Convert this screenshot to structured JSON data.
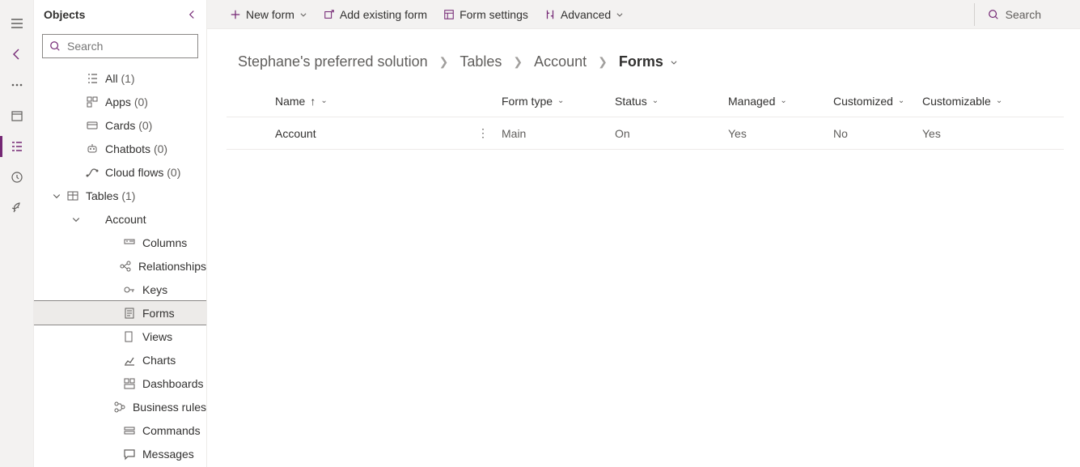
{
  "iconRail": [
    "menu",
    "back",
    "more",
    "package",
    "tree",
    "history",
    "rocket"
  ],
  "objects": {
    "title": "Objects",
    "searchPlaceholder": "Search",
    "items": [
      {
        "label": "All",
        "count": "(1)",
        "icon": "list"
      },
      {
        "label": "Apps",
        "count": "(0)",
        "icon": "apps"
      },
      {
        "label": "Cards",
        "count": "(0)",
        "icon": "card"
      },
      {
        "label": "Chatbots",
        "count": "(0)",
        "icon": "bot"
      },
      {
        "label": "Cloud flows",
        "count": "(0)",
        "icon": "flow"
      }
    ],
    "tables": {
      "label": "Tables",
      "count": "(1)",
      "icon": "table"
    },
    "account": {
      "label": "Account"
    },
    "children": [
      {
        "label": "Columns",
        "icon": "column"
      },
      {
        "label": "Relationships",
        "icon": "relationship"
      },
      {
        "label": "Keys",
        "icon": "key"
      },
      {
        "label": "Forms",
        "icon": "form",
        "selected": true
      },
      {
        "label": "Views",
        "icon": "view"
      },
      {
        "label": "Charts",
        "icon": "chart"
      },
      {
        "label": "Dashboards",
        "icon": "dashboard"
      },
      {
        "label": "Business rules",
        "icon": "rules"
      },
      {
        "label": "Commands",
        "icon": "command"
      },
      {
        "label": "Messages",
        "icon": "message"
      }
    ]
  },
  "toolbar": {
    "newForm": "New form",
    "addExisting": "Add existing form",
    "formSettings": "Form settings",
    "advanced": "Advanced",
    "search": "Search"
  },
  "breadcrumb": {
    "solution": "Stephane's preferred solution",
    "tables": "Tables",
    "entity": "Account",
    "forms": "Forms"
  },
  "grid": {
    "columns": {
      "name": "Name",
      "formType": "Form type",
      "status": "Status",
      "managed": "Managed",
      "customized": "Customized",
      "customizable": "Customizable"
    },
    "rows": [
      {
        "name": "Account",
        "formType": "Main",
        "status": "On",
        "managed": "Yes",
        "customized": "No",
        "customizable": "Yes"
      }
    ]
  }
}
